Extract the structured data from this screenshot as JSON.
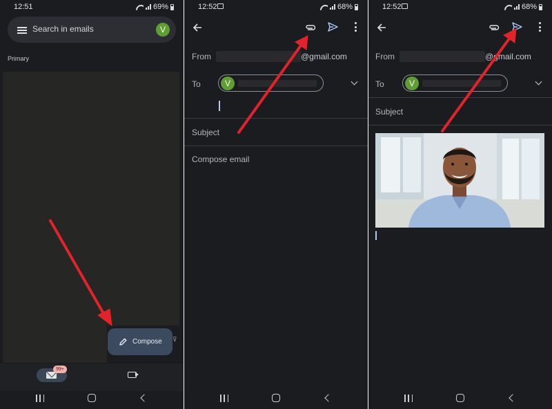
{
  "panel1": {
    "status": {
      "time": "12:51",
      "battery": "69%"
    },
    "search": {
      "placeholder": "Search in emails",
      "avatar_letter": "V"
    },
    "section_label": "Primary",
    "compose_button": "Compose",
    "side_glyph": "⊽",
    "bottom_nav": {
      "mail_badge": "99+",
      "icons": [
        "mail-icon",
        "video-camera-icon"
      ]
    },
    "system_nav": [
      "recents-icon",
      "home-icon",
      "back-icon"
    ]
  },
  "panel2": {
    "status": {
      "time": "12:52",
      "battery": "68%"
    },
    "toolbar_icons": [
      "back-arrow-icon",
      "attachment-icon",
      "send-icon",
      "more-vertical-icon"
    ],
    "from_label": "From",
    "from_suffix": "@gmail.com",
    "to_label": "To",
    "recipient_avatar": "V",
    "subject_placeholder": "Subject",
    "body_placeholder": "Compose email"
  },
  "panel3": {
    "status": {
      "time": "12:52",
      "battery": "68%"
    },
    "toolbar_icons": [
      "back-arrow-icon",
      "attachment-icon",
      "send-icon",
      "more-vertical-icon"
    ],
    "from_label": "From",
    "from_suffix": "@gmail.com",
    "to_label": "To",
    "recipient_avatar": "V",
    "subject_placeholder": "Subject",
    "attached_image": "photo of smiling man in light blue shirt"
  },
  "colors": {
    "background": "#1b1c20",
    "accent_blue": "#aecbfa",
    "avatar_green": "#5f9e33",
    "fab": "#3c4a5f",
    "annotation_red": "#e3232a"
  }
}
